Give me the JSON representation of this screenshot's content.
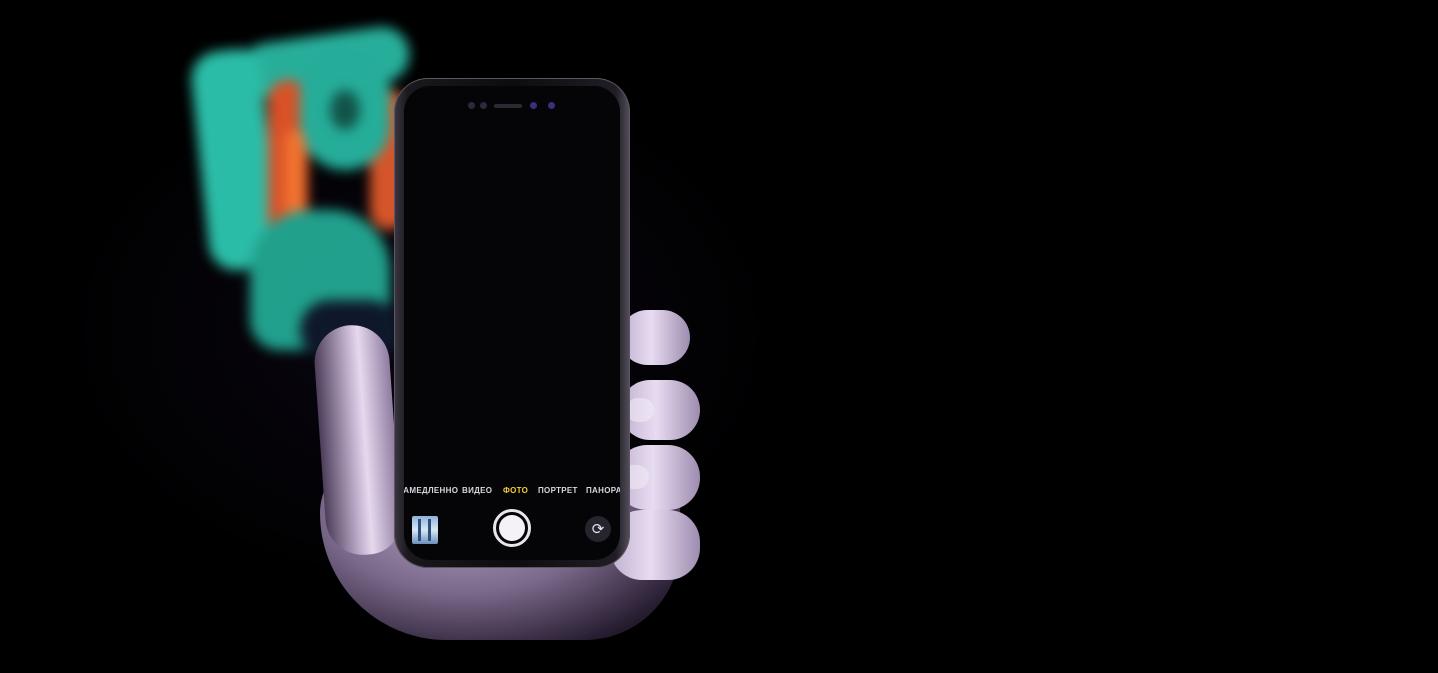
{
  "camera": {
    "modes": [
      {
        "label": "ЗАМЕДЛЕННО",
        "active": false
      },
      {
        "label": "ВИДЕО",
        "active": false
      },
      {
        "label": "ФОТО",
        "active": true
      },
      {
        "label": "ПОРТРЕТ",
        "active": false
      },
      {
        "label": "ПАНОРАМА",
        "active": false
      }
    ],
    "active_mode_color": "#f3cb3a",
    "switch_icon_glyph": "⟳",
    "icons": {
      "shutter": "shutter-button",
      "gallery": "gallery-thumbnail",
      "switch": "camera-switch-icon"
    }
  }
}
